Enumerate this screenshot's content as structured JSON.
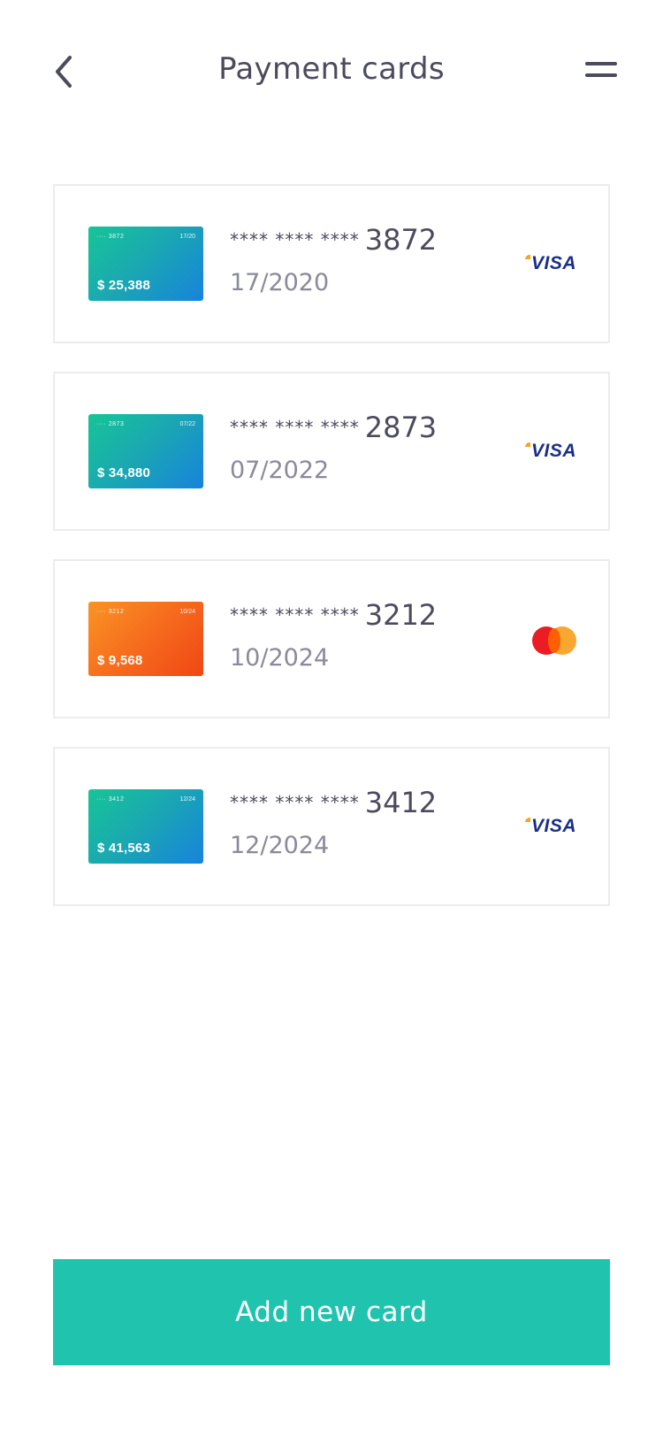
{
  "header": {
    "title": "Payment cards"
  },
  "cards": [
    {
      "mini_number": "···· 3872",
      "mini_expiry": "17/20",
      "balance": "$ 25,388",
      "mask": "**** **** ****",
      "last4": "3872",
      "expiry": "17/2020",
      "brand": "visa",
      "brand_label": "VISA",
      "theme": "teal"
    },
    {
      "mini_number": "···· 2873",
      "mini_expiry": "07/22",
      "balance": "$ 34,880",
      "mask": "**** **** ****",
      "last4": "2873",
      "expiry": "07/2022",
      "brand": "visa",
      "brand_label": "VISA",
      "theme": "teal"
    },
    {
      "mini_number": "···· 3212",
      "mini_expiry": "10/24",
      "balance": "$ 9,568",
      "mask": "**** **** ****",
      "last4": "3212",
      "expiry": "10/2024",
      "brand": "mastercard",
      "theme": "orange"
    },
    {
      "mini_number": "···· 3412",
      "mini_expiry": "12/24",
      "balance": "$ 41,563",
      "mask": "**** **** ****",
      "last4": "3412",
      "expiry": "12/2024",
      "brand": "visa",
      "brand_label": "VISA",
      "theme": "teal"
    }
  ],
  "actions": {
    "add_card_label": "Add new card"
  },
  "colors": {
    "accent": "#20c4ae",
    "text_primary": "#4b4b5e",
    "text_secondary": "#8a8a99",
    "visa_blue": "#1a2f86",
    "mc_red": "#ea1d25",
    "mc_yellow": "#f79f1e"
  },
  "icons": {
    "back": "chevron-left-icon",
    "menu": "menu-icon",
    "visa": "visa-logo-icon",
    "mastercard": "mastercard-logo-icon"
  }
}
